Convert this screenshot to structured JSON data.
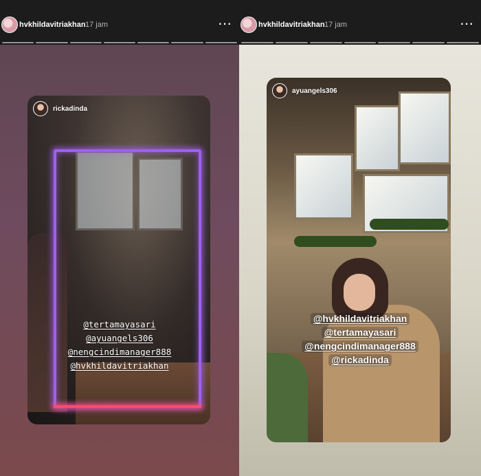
{
  "stories": [
    {
      "header": {
        "username": "hvkhildavitriakhan",
        "timestamp": "17 jam",
        "more_icon": "more-horizontal-icon"
      },
      "progress_segments": 7,
      "repost": {
        "username": "rickadinda",
        "mentions": [
          "@tertamayasari",
          "@ayuangels306",
          "@nengcindimanager888",
          "@hvkhildavitriakhan"
        ]
      }
    },
    {
      "header": {
        "username": "hvkhildavitriakhan",
        "timestamp": "17 jam",
        "more_icon": "more-horizontal-icon"
      },
      "progress_segments": 7,
      "repost": {
        "username": "ayuangels306",
        "mentions": [
          "@hvkhildavitriakhan",
          "@tertamayasari",
          "@nengcindimanager888",
          "@rickadinda"
        ]
      }
    }
  ],
  "colors": {
    "header_bg": "#1c1c1c",
    "left_bg": "#6e4b5e",
    "right_bg": "#d8d5c7",
    "neon_purple": "#a05ff0",
    "neon_red": "#ff4b6e"
  }
}
